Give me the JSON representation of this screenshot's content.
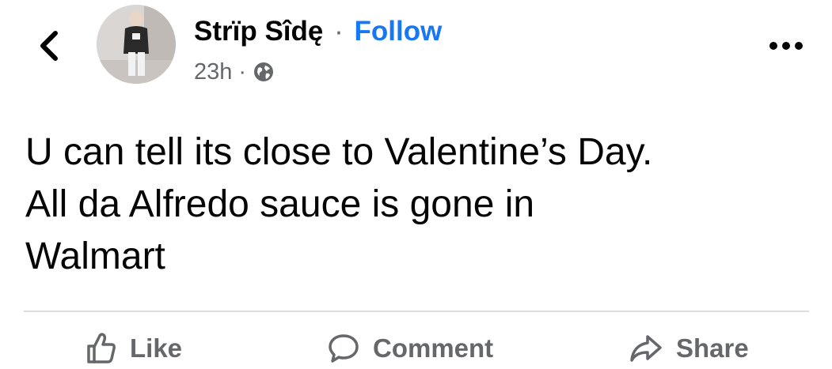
{
  "post": {
    "author": "Strïp Sîdę",
    "separator": "·",
    "follow_label": "Follow",
    "time": "23h",
    "meta_separator": "·",
    "privacy_icon": "globe-icon",
    "text_lines": [
      "U can tell its close to Valentine’s Day.",
      "All da Alfredo sauce is gone in",
      "Walmart"
    ]
  },
  "actions": {
    "like_label": "Like",
    "comment_label": "Comment",
    "share_label": "Share"
  },
  "colors": {
    "link": "#1877f2",
    "secondary_text": "#65676b",
    "primary_text": "#050505",
    "divider": "#dcdde1"
  }
}
